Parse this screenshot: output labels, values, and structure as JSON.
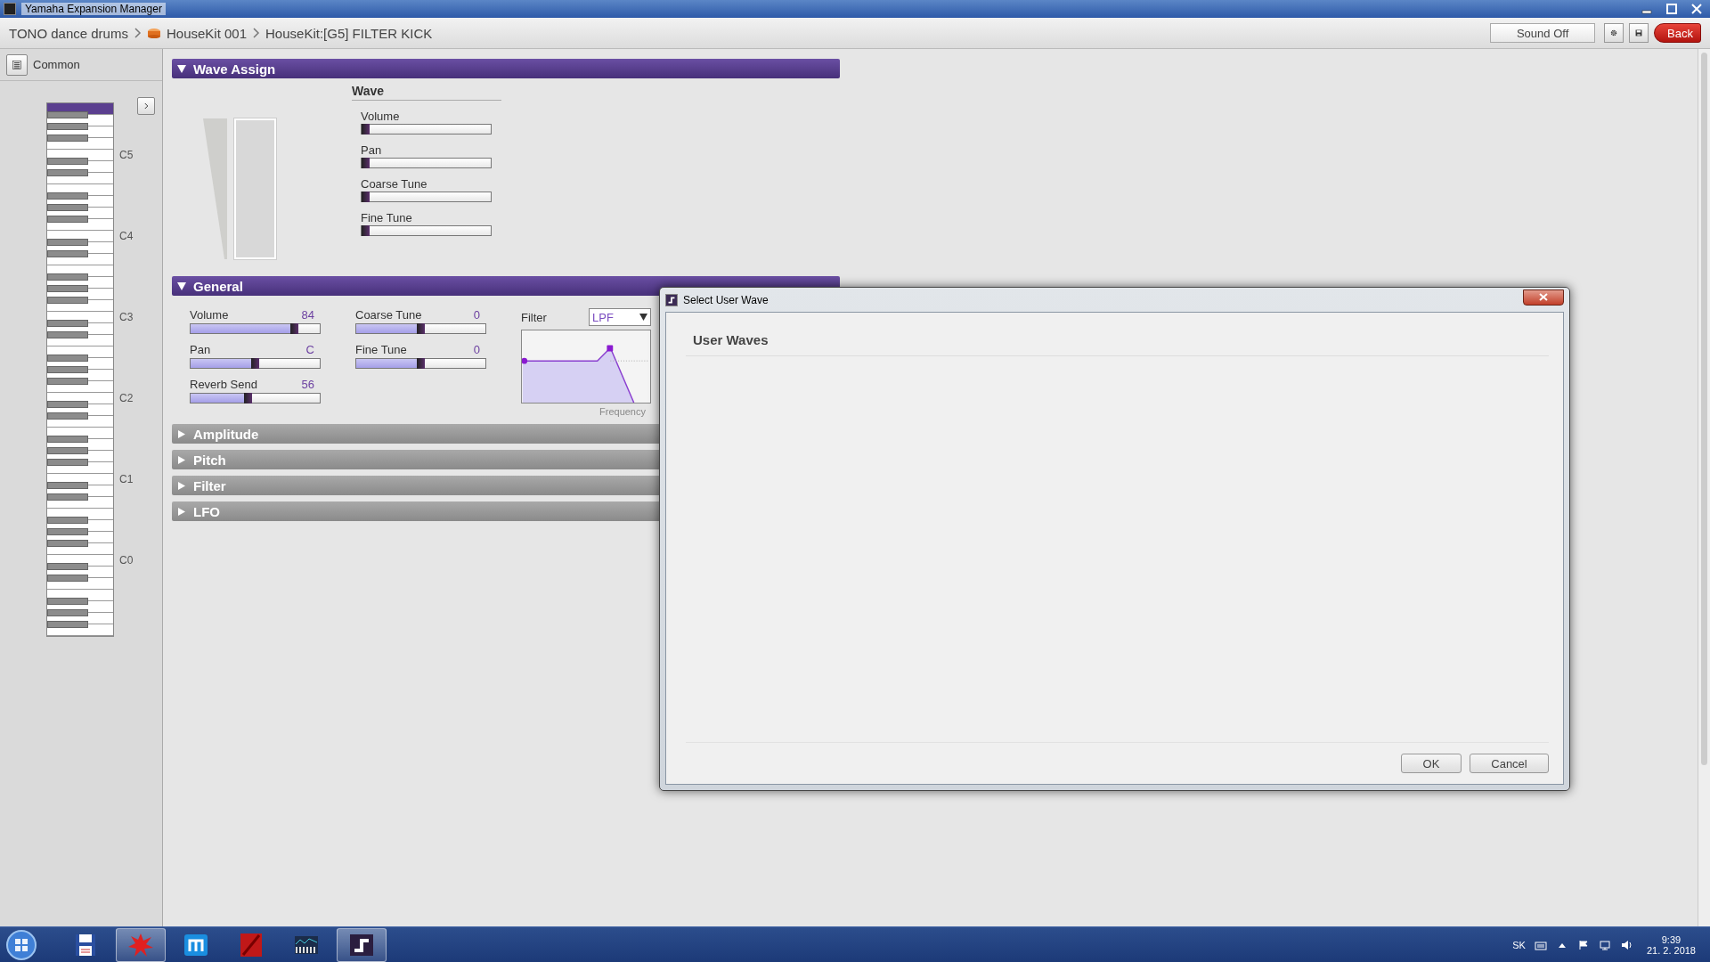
{
  "window": {
    "title": "Yamaha Expansion Manager"
  },
  "breadcrumb": [
    {
      "label": "TONO dance drums",
      "kind": "text"
    },
    {
      "label": "HouseKit 001",
      "kind": "kit"
    },
    {
      "label": "HouseKit:[G5] FILTER KICK",
      "kind": "text"
    }
  ],
  "toolbar": {
    "sound_button": "Sound Off",
    "back_button": "Back"
  },
  "sidebar": {
    "common_label": "Common",
    "octaves": [
      "C5",
      "C4",
      "C3",
      "C2",
      "C1",
      "C0"
    ]
  },
  "wave_assign": {
    "title": "Wave Assign",
    "expanded": true,
    "wave_label": "Wave",
    "sliders": [
      {
        "label": "Volume",
        "level": 0
      },
      {
        "label": "Pan",
        "level": 0
      },
      {
        "label": "Coarse Tune",
        "level": 0
      },
      {
        "label": "Fine Tune",
        "level": 0
      }
    ]
  },
  "general": {
    "title": "General",
    "expanded": true,
    "columns": [
      [
        {
          "label": "Volume",
          "reading": "84",
          "level": 0.82
        },
        {
          "label": "Pan",
          "reading": "C",
          "level": 0.5
        },
        {
          "label": "Reverb Send",
          "reading": "56",
          "level": 0.44
        }
      ],
      [
        {
          "label": "Coarse Tune",
          "reading": "0",
          "level": 0.5
        },
        {
          "label": "Fine Tune",
          "reading": "0",
          "level": 0.5
        }
      ]
    ],
    "filter": {
      "label": "Filter",
      "type": "LPF",
      "axis_label": "Frequency"
    }
  },
  "sections": [
    {
      "title": "Amplitude",
      "expanded": false
    },
    {
      "title": "Pitch",
      "expanded": false
    },
    {
      "title": "Filter",
      "expanded": false
    },
    {
      "title": "LFO",
      "expanded": false
    }
  ],
  "dialog": {
    "title": "Select User Wave",
    "heading": "User Waves",
    "buttons": [
      "OK",
      "Cancel"
    ]
  },
  "taskbar": {
    "items": [
      {
        "kind": "disk",
        "active": false
      },
      {
        "kind": "splat",
        "active": true
      },
      {
        "kind": "browser",
        "active": false
      },
      {
        "kind": "red",
        "active": false
      },
      {
        "kind": "meter",
        "active": false
      },
      {
        "kind": "app",
        "active": true
      }
    ],
    "language": "SK",
    "time": "9:39",
    "date": "21. 2. 2018"
  }
}
